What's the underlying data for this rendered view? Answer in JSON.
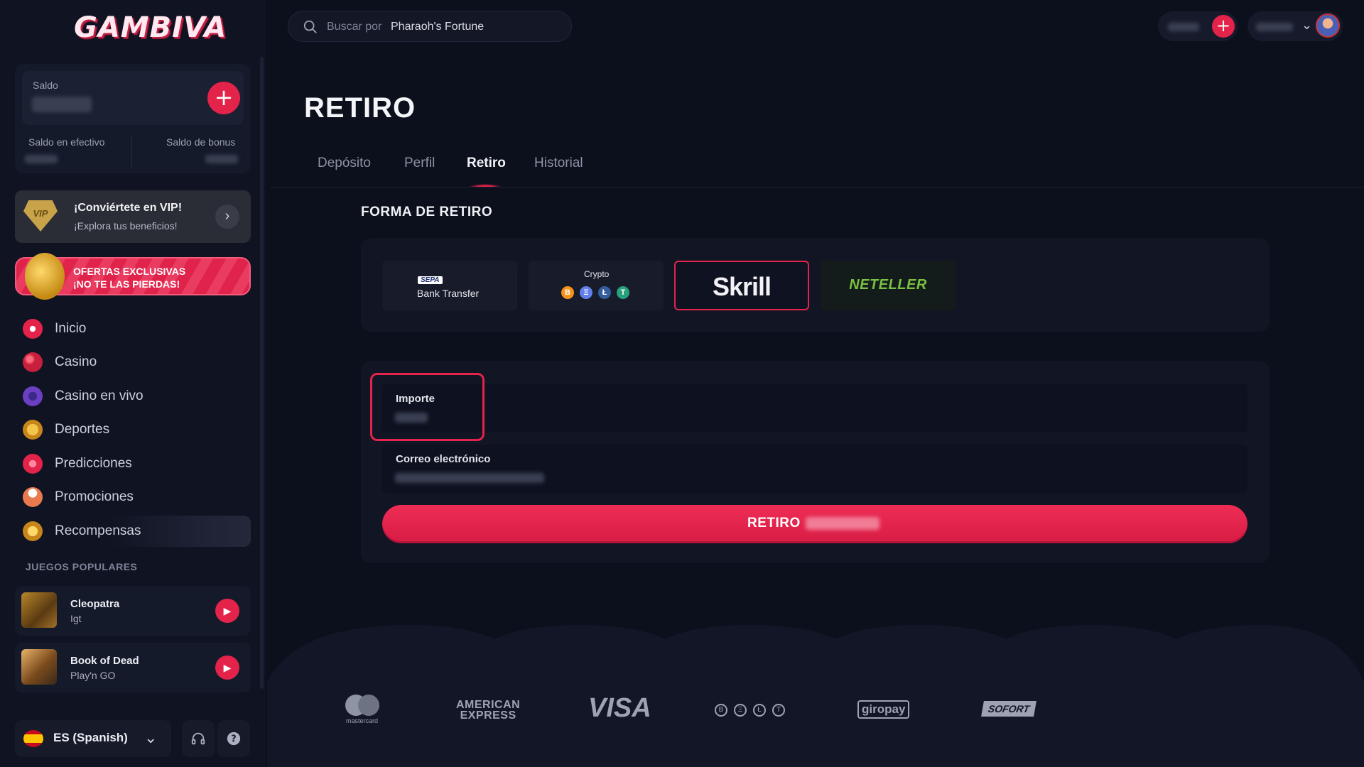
{
  "brand": {
    "logo_text": "GAMBIVA"
  },
  "search": {
    "prefix": "Buscar por",
    "term": "Pharaoh's Fortune"
  },
  "balance": {
    "label": "Saldo",
    "cash_label": "Saldo en efectivo",
    "bonus_label": "Saldo de bonus"
  },
  "vip": {
    "badge": "VIP",
    "title": "¡Conviértete en VIP!",
    "subtitle": "¡Explora tus beneficios!"
  },
  "offer": {
    "line1": "OFERTAS EXCLUSIVAS",
    "line2": "¡NO TE LAS PIERDAS!"
  },
  "nav": {
    "items": [
      {
        "label": "Inicio",
        "icon": "swirl-icon",
        "color": "#e3234a"
      },
      {
        "label": "Casino",
        "icon": "cherry-icon",
        "color": "#c8203c"
      },
      {
        "label": "Casino en vivo",
        "icon": "chip-icon",
        "color": "#6a3fc2"
      },
      {
        "label": "Deportes",
        "icon": "medal-icon",
        "color": "#e0a12a"
      },
      {
        "label": "Predicciones",
        "icon": "chart-up-icon",
        "color": "#e3234a"
      },
      {
        "label": "Promociones",
        "icon": "cake-icon",
        "color": "#e97a4f"
      },
      {
        "label": "Recompensas",
        "icon": "coin-icon",
        "color": "#e0a12a"
      }
    ]
  },
  "popular": {
    "heading": "JUEGOS POPULARES",
    "games": [
      {
        "title": "Cleopatra",
        "provider": "Igt"
      },
      {
        "title": "Book of Dead",
        "provider": "Play'n GO"
      }
    ]
  },
  "language": {
    "label": "ES (Spanish)"
  },
  "page": {
    "title": "RETIRO",
    "tabs": [
      "Depósito",
      "Perfil",
      "Retiro",
      "Historial"
    ],
    "active_tab": "Retiro",
    "form_heading": "FORMA DE RETIRO"
  },
  "methods": {
    "bank": {
      "tag": "SEPA",
      "label": "Bank Transfer"
    },
    "crypto": {
      "label": "Crypto",
      "coins": [
        "B",
        "Ξ",
        "Ł",
        "T"
      ]
    },
    "skrill": {
      "label": "Skrill"
    },
    "neteller": {
      "label": "NETELLER"
    },
    "selected": "Skrill"
  },
  "form": {
    "amount_label": "Importe",
    "email_label": "Correo electrónico",
    "submit_label": "RETIRO"
  },
  "footer": {
    "mastercard": "mastercard",
    "amex_line1": "AMERICAN",
    "amex_line2": "EXPRESS",
    "visa": "VISA",
    "crypto_coins": [
      "B",
      "Ξ",
      "Ł",
      "T"
    ],
    "giropay": "giropay",
    "sofort": "SOFORT"
  },
  "colors": {
    "accent": "#e3234a",
    "background": "#0c0f1c",
    "panel": "#111524"
  }
}
